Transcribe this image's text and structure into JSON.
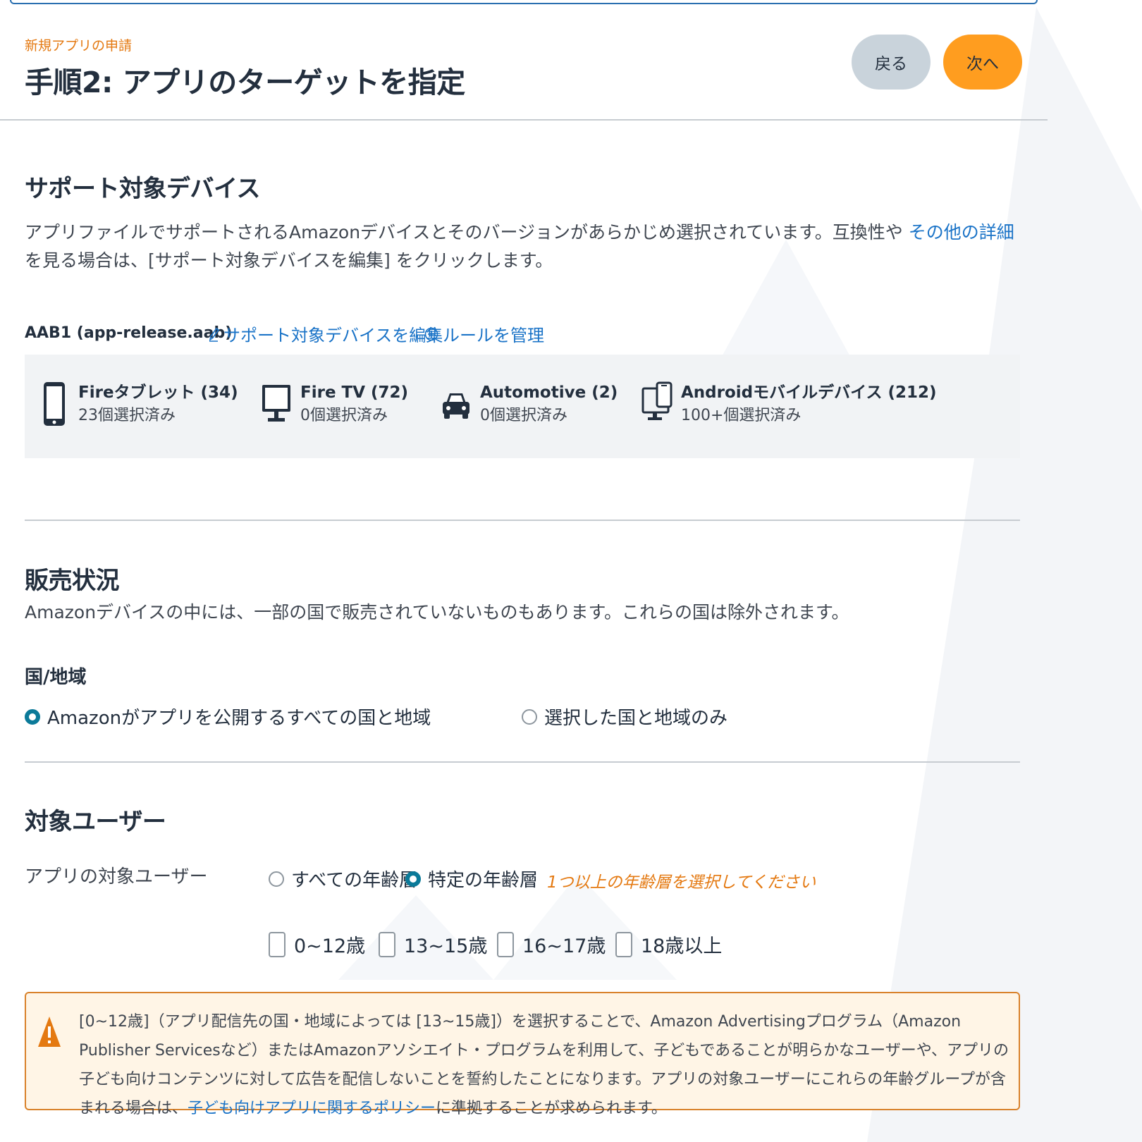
{
  "header": {
    "breadcrumb": "新規アプリの申請",
    "title": "手順2: アプリのターゲットを指定",
    "back_label": "戻る",
    "next_label": "次へ"
  },
  "supported_devices": {
    "heading": "サポート対象デバイス",
    "description_before": "アプリファイルでサポートされるAmazonデバイスとそのバージョンがあらかじめ選択されています。互換性や ",
    "description_link": "その他の詳細",
    "description_after": "を見る場合は、[サポート対象デバイスを編集] をクリックします。",
    "file_label": "AAB1 (app-release.aab)",
    "edit_link": "サポート対象デバイスを編集",
    "rules_link": "ルールを管理",
    "devices": [
      {
        "name": "Fireタブレット (34)",
        "count": "23個選択済み",
        "icon": "tablet-icon"
      },
      {
        "name": "Fire TV (72)",
        "count": "0個選択済み",
        "icon": "tv-icon"
      },
      {
        "name": "Automotive (2)",
        "count": "0個選択済み",
        "icon": "car-icon"
      },
      {
        "name": "Androidモバイルデバイス (212)",
        "count": "100+個選択済み",
        "icon": "mobile-devices-icon"
      }
    ]
  },
  "availability": {
    "heading": "販売状況",
    "description": "Amazonデバイスの中には、一部の国で販売されていないものもあります。これらの国は除外されます。",
    "region_label": "国/地域",
    "option_all": "Amazonがアプリを公開するすべての国と地域",
    "option_selected": "選択した国と地域のみ",
    "selected": "all"
  },
  "audience": {
    "heading": "対象ユーザー",
    "label": "アプリの対象ユーザー",
    "option_all": "すべての年齢層",
    "option_specific": "特定の年齢層",
    "selected": "specific",
    "warning": "1つ以上の年齢層を選択してください",
    "age_groups": [
      "0~12歳",
      "13~15歳",
      "16~17歳",
      "18歳以上"
    ]
  },
  "alert": {
    "text_before": "[0~12歳]（アプリ配信先の国・地域によっては [13~15歳]）を選択することで、Amazon Advertisingプログラム（Amazon Publisher Servicesなど）またはAmazonアソシエイト・プログラムを利用して、子どもであることが明らかなユーザーや、アプリの子ども向けコンテンツに対して広告を配信しないことを誓約したことになります。アプリの対象ユーザーにこれらの年齢グループが含まれる場合は、",
    "link": "子ども向けアプリに関するポリシー",
    "text_after": "に準拠することが求められます。"
  },
  "colors": {
    "accent_orange": "#ff9d1f",
    "link_blue": "#1a73c7",
    "radio_teal": "#0b7a99",
    "warning_orange": "#e47911"
  }
}
